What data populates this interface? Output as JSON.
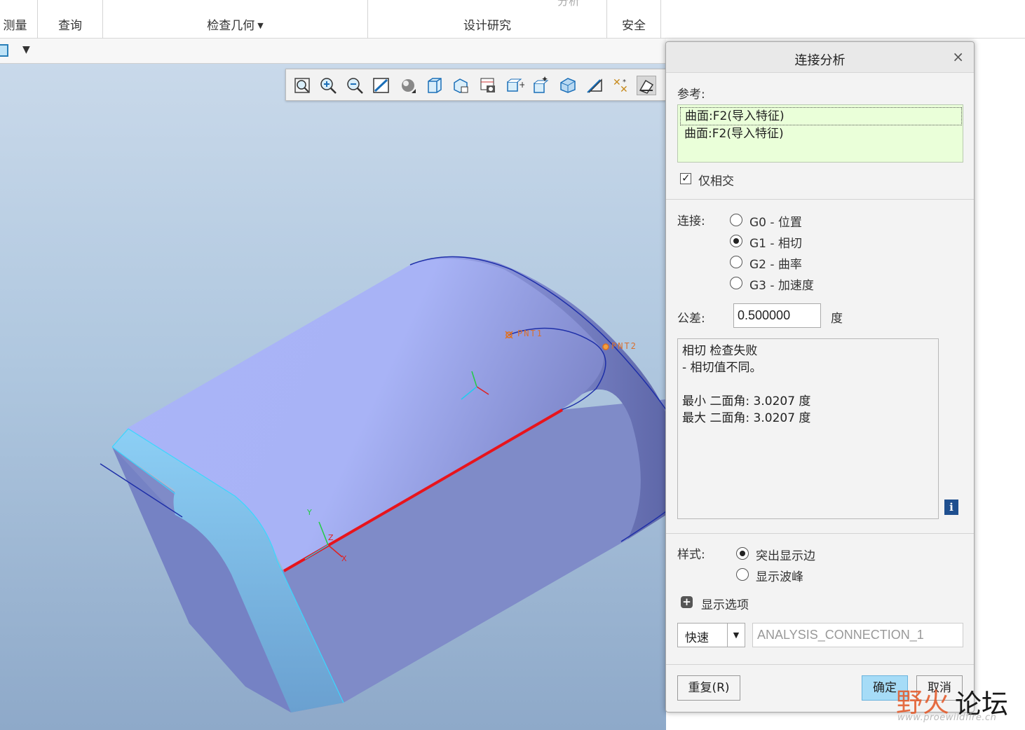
{
  "ribbon": {
    "groups": [
      {
        "label": "测量"
      },
      {
        "label": "查询"
      },
      {
        "label": "检查几何"
      },
      {
        "label": "设计研究"
      },
      {
        "label": "安全"
      }
    ],
    "cutoff_labels": [
      "分析"
    ]
  },
  "viewport": {
    "points": [
      "PNT1",
      "PNT2"
    ],
    "csys_labels": {
      "y": "Y",
      "z": "Z",
      "x": "X"
    }
  },
  "dialog": {
    "title": "连接分析",
    "references_label": "参考:",
    "references": [
      "曲面:F2(导入特征)",
      "曲面:F2(导入特征)"
    ],
    "intersect_only": {
      "label": "仅相交",
      "checked": true
    },
    "connection_label": "连接:",
    "connection_options": [
      {
        "label": "G0 - 位置",
        "selected": false
      },
      {
        "label": "G1 - 相切",
        "selected": true
      },
      {
        "label": "G2 - 曲率",
        "selected": false
      },
      {
        "label": "G3 - 加速度",
        "selected": false
      }
    ],
    "tolerance_label": "公差:",
    "tolerance_value": "0.500000",
    "tolerance_unit": "度",
    "result_lines": [
      "相切 检查失败",
      "- 相切值不同。",
      "",
      "最小 二面角: 3.0207 度",
      "最大 二面角: 3.0207 度"
    ],
    "style_label": "样式:",
    "style_options": [
      {
        "label": "突出显示边",
        "selected": true
      },
      {
        "label": "显示波峰",
        "selected": false
      }
    ],
    "display_options_label": "显示选项",
    "mode_value": "快速",
    "analysis_name": "ANALYSIS_CONNECTION_1",
    "buttons": {
      "repeat": "重复(R)",
      "ok": "确定",
      "cancel": "取消"
    }
  },
  "watermark": {
    "brand_a": "野火",
    "brand_b": "论坛",
    "url": "www.proewildfire.cn"
  },
  "colors": {
    "ok_button": "#a6dcf7",
    "ref_list_bg": "#eaffd9",
    "highlight_edge": "#e8141c",
    "surface": "#9ba7ef"
  }
}
